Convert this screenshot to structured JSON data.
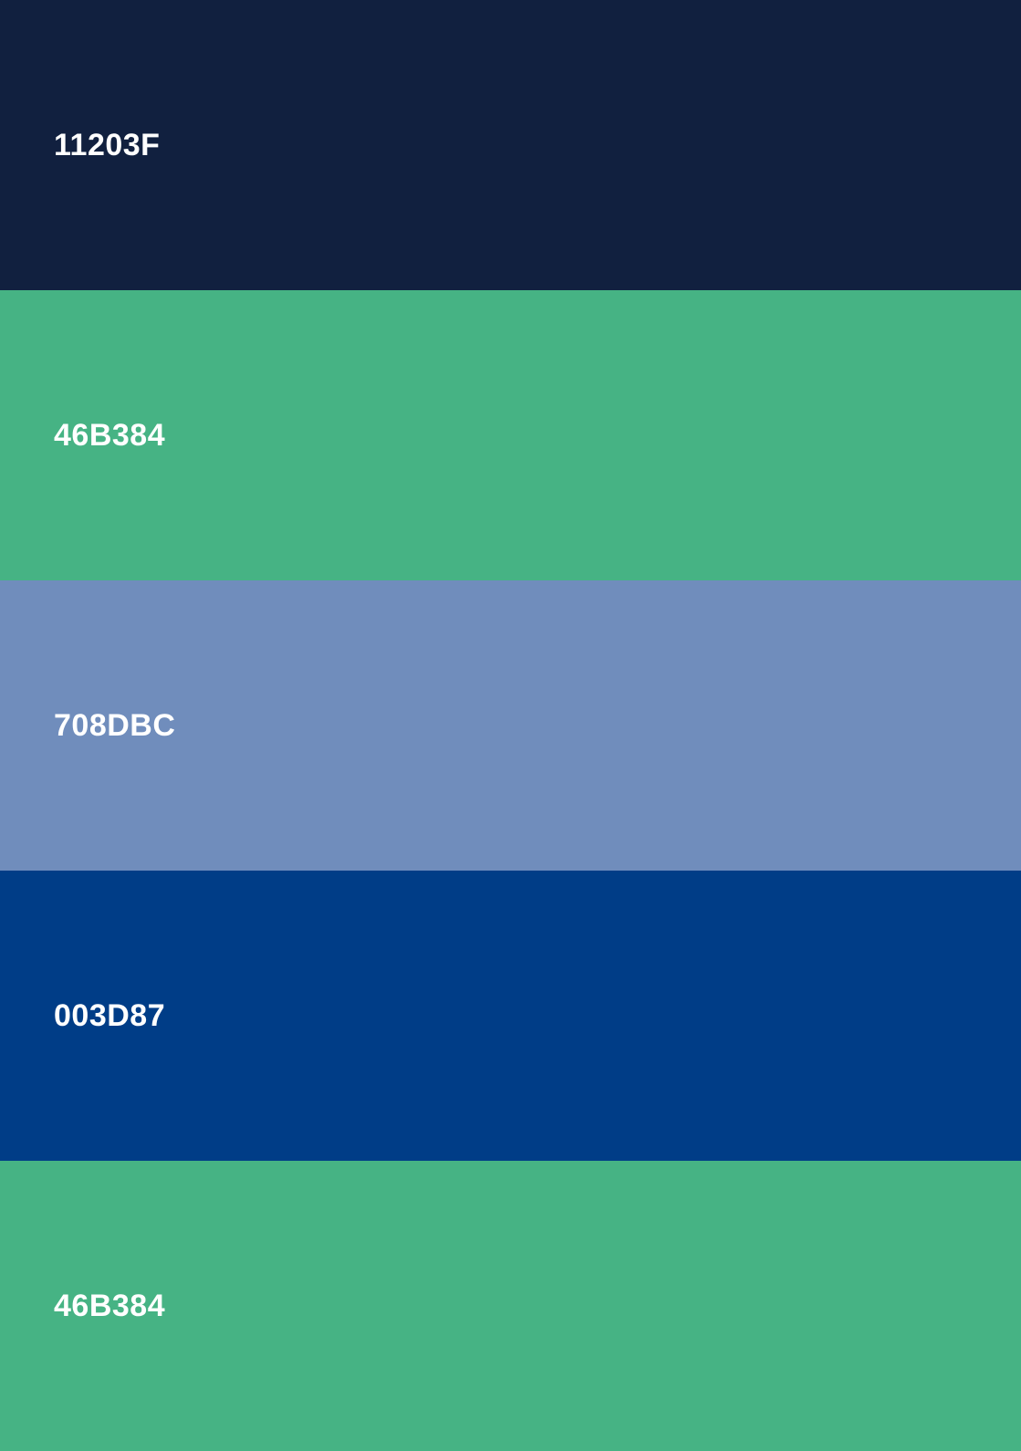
{
  "swatches": [
    {
      "label": "11203F",
      "color": "#11203F"
    },
    {
      "label": "46B384",
      "color": "#46B384"
    },
    {
      "label": "708DBC",
      "color": "#708DBC"
    },
    {
      "label": "003D87",
      "color": "#003D87"
    },
    {
      "label": "46B384",
      "color": "#46B384"
    }
  ]
}
